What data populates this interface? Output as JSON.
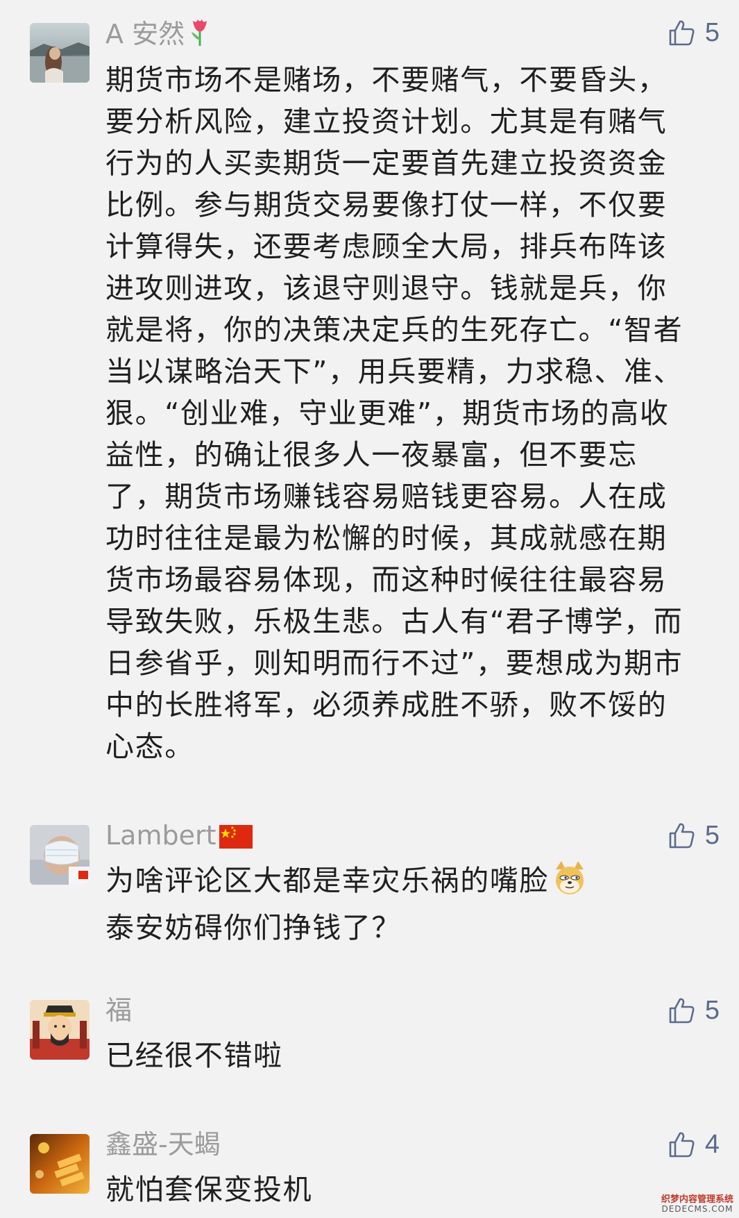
{
  "comments": [
    {
      "username": "A 安然",
      "username_badge_icon": "tulip-icon",
      "avatar_icon": "avatar-beach-photo",
      "likes": "5",
      "body": "期货市场不是赌场，不要赌气，不要昏头，要分析风险，建立投资计划。尤其是有赌气行为的人买卖期货一定要首先建立投资资金比例。参与期货交易要像打仗一样，不仅要计算得失，还要考虑顾全大局，排兵布阵该进攻则进攻，该退守则退守。钱就是兵，你就是将，你的决策决定兵的生死存亡。“智者当以谋略治天下”，用兵要精，力求稳、准、狠。“创业难，守业更难”，期货市场的高收益性，的确让很多人一夜暴富，但不要忘了，期货市场赚钱容易赔钱更容易。人在成功时往往是最为松懈的时候，其成就感在期货市场最容易体现，而这种时候往往最容易导致失败，乐极生悲。古人有“君子博学，而日参省乎，则知明而行不过”，要想成为期市中的长胜将军，必须养成胜不骄，败不馁的心态。"
    },
    {
      "username": "Lambert",
      "username_badge_icon": "china-flag-icon",
      "avatar_icon": "avatar-masked-photo",
      "likes": "5",
      "body_line1": "为啥评论区大都是幸灾乐祸的嘴脸",
      "body_emoji_icon": "doge-emoji-icon",
      "body_line2": "泰安妨碍你们挣钱了？"
    },
    {
      "username": "福",
      "avatar_icon": "avatar-caishen-illustration",
      "likes": "5",
      "body": "已经很不错啦"
    },
    {
      "username": "鑫盛-天蝎",
      "avatar_icon": "avatar-gold-photo",
      "likes": "4",
      "body": "就怕套保变投机"
    }
  ],
  "watermark": {
    "line1": "织梦内容管理系统",
    "line2": "DEDECMS.COM"
  },
  "colors": {
    "background": "#f2f2f2",
    "username": "#9b9b9b",
    "body_text": "#1f1f1f",
    "like_icon": "#5b6b8c"
  }
}
